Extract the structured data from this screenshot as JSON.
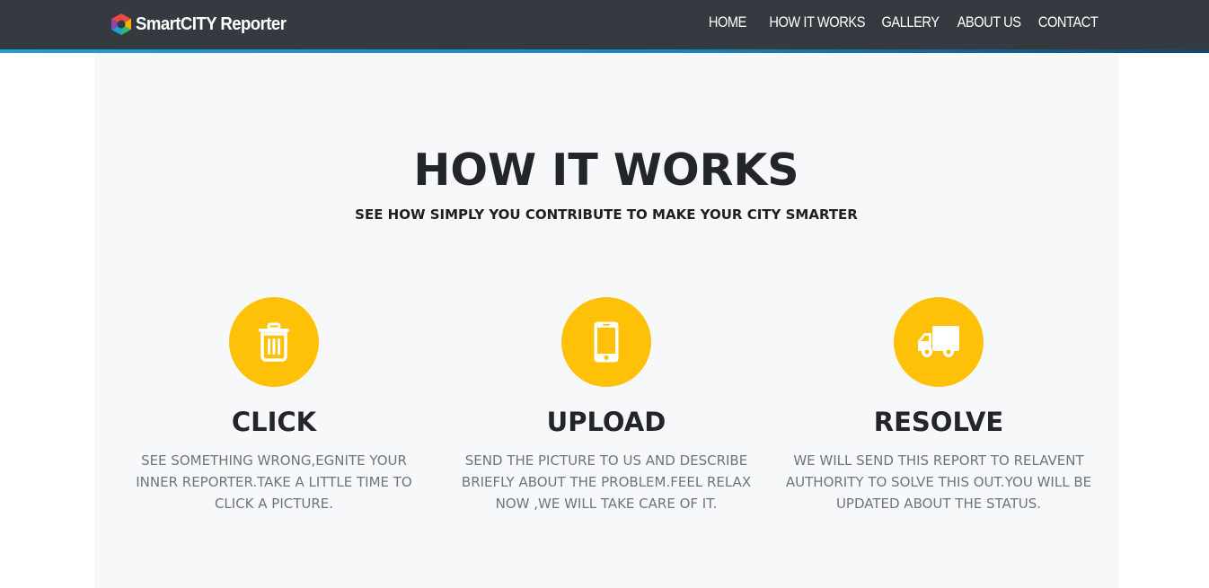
{
  "navbar": {
    "brand": "SmartCITY Reporter",
    "links": [
      "Home",
      "How It Works",
      "Gallery",
      "About Us",
      "Contact"
    ]
  },
  "colors": {
    "navbar_bg": "#343a40",
    "accent": "#1b86bd",
    "icon_circle": "#fec107",
    "section_bg": "#f7f8f9"
  },
  "section": {
    "title": "HOW IT WORKS",
    "subtitle": "SEE HOW SIMPLY YOU CONTRIBUTE TO MAKE YOUR CITY SMARTER"
  },
  "steps": [
    {
      "icon": "trash-icon",
      "title": "CLICK",
      "text": "SEE SOMETHING WRONG,EGNITE YOUR INNER REPORTER.TAKE A LITTLE TIME TO CLICK A PICTURE."
    },
    {
      "icon": "mobile-phone-icon",
      "title": "UPLOAD",
      "text": "SEND THE PICTURE TO US AND DESCRIBE BRIEFLY ABOUT THE PROBLEM.FEEL RELAX NOW ,WE WILL TAKE CARE OF IT."
    },
    {
      "icon": "truck-icon",
      "title": "RESOLVE",
      "text": "WE WILL SEND THIS REPORT TO RELAVENT AUTHORITY TO SOLVE THIS OUT.YOU WILL BE UPDATED ABOUT THE STATUS."
    }
  ]
}
